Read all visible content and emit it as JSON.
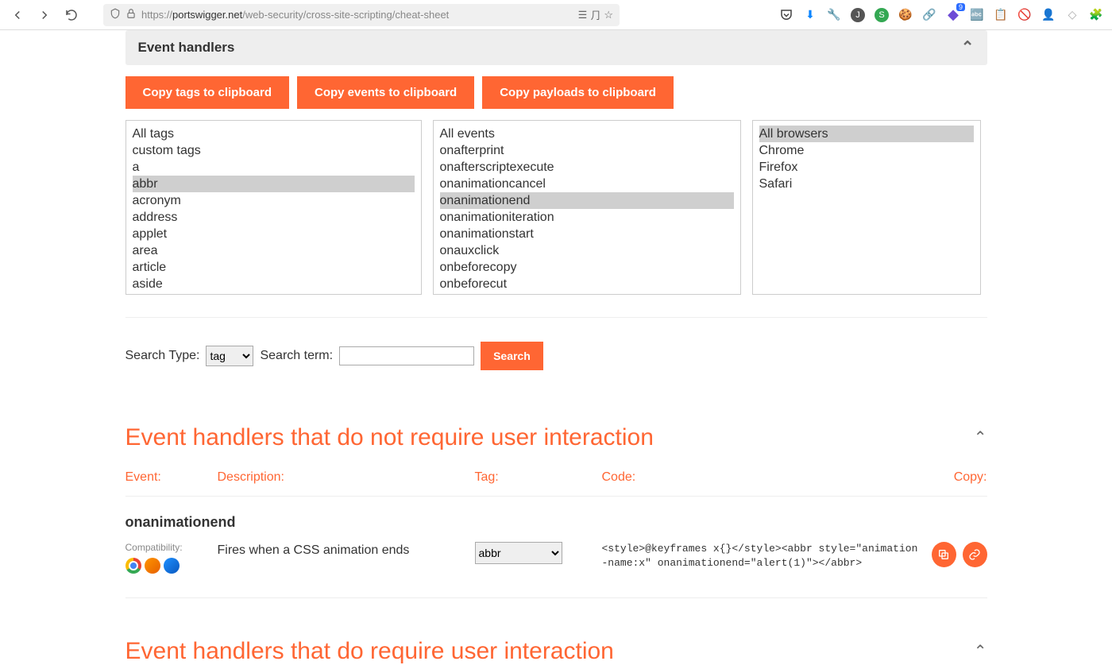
{
  "browser": {
    "url_prefix": "https://",
    "url_domain": "portswigger.net",
    "url_path": "/web-security/cross-site-scripting/cheat-sheet",
    "ext_badge": "9"
  },
  "section": {
    "title": "Event handlers",
    "copy_tags": "Copy tags to clipboard",
    "copy_events": "Copy events to clipboard",
    "copy_payloads": "Copy payloads to clipboard"
  },
  "tags": [
    "All tags",
    "custom tags",
    "a",
    "abbr",
    "acronym",
    "address",
    "applet",
    "area",
    "article",
    "aside"
  ],
  "tags_selected": "abbr",
  "events": [
    "All events",
    "onafterprint",
    "onafterscriptexecute",
    "onanimationcancel",
    "onanimationend",
    "onanimationiteration",
    "onanimationstart",
    "onauxclick",
    "onbeforecopy",
    "onbeforecut"
  ],
  "events_selected": "onanimationend",
  "browsers": [
    "All browsers",
    "Chrome",
    "Firefox",
    "Safari"
  ],
  "browsers_selected": "All browsers",
  "search": {
    "type_label": "Search Type:",
    "type_value": "tag",
    "term_label": "Search term:",
    "button": "Search"
  },
  "heading_no_interaction": "Event handlers that do not require user interaction",
  "heading_interaction": "Event handlers that do require user interaction",
  "cols": {
    "event": "Event:",
    "desc": "Description:",
    "tag": "Tag:",
    "code": "Code:",
    "copy": "Copy:"
  },
  "result": {
    "event": "onanimationend",
    "compat_label": "Compatibility:",
    "description": "Fires when a CSS animation ends",
    "tag_select": "abbr",
    "code": "<style>@keyframes x{}</style><abbr style=\"animation-name:x\" onanimationend=\"alert(1)\"></abbr>"
  }
}
